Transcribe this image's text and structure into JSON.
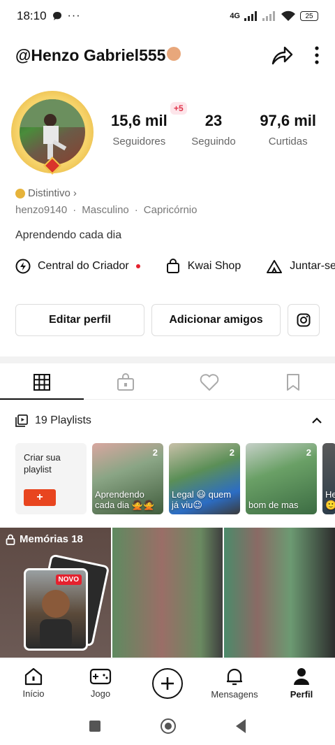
{
  "status": {
    "time": "18:10",
    "network": "4G",
    "battery": "25"
  },
  "header": {
    "username": "@Henzo Gabriel555"
  },
  "stats": [
    {
      "value": "15,6 mil",
      "label": "Seguidores"
    },
    {
      "value": "23",
      "label": "Seguindo"
    },
    {
      "value": "97,6 mil",
      "label": "Curtidas"
    }
  ],
  "plus_badge": "+5",
  "profile": {
    "distintivo": "Distintivo",
    "handle": "henzo9140",
    "gender": "Masculino",
    "sign": "Capricórnio",
    "bio": "Aprendendo cada dia"
  },
  "links": [
    {
      "label": "Central do Criador"
    },
    {
      "label": "Kwai Shop"
    },
    {
      "label": "Juntar-se"
    }
  ],
  "buttons": {
    "edit": "Editar perfil",
    "add_friends": "Adicionar amigos"
  },
  "playlists": {
    "header": "19 Playlists",
    "create_label": "Criar sua playlist",
    "create_button": "+",
    "items": [
      {
        "count": "2",
        "title": "Aprendendo cada dia 🙅🙅"
      },
      {
        "count": "2",
        "title": "Legal 😃 quem já viu😉"
      },
      {
        "count": "2",
        "title": "bom de mas"
      },
      {
        "count": "",
        "title": "He 🙂"
      }
    ]
  },
  "memories": {
    "label": "Memórias 18",
    "badge": "NOVO"
  },
  "nav": {
    "home": "Início",
    "game": "Jogo",
    "messages": "Mensagens",
    "profile": "Perfil"
  },
  "colors": {
    "accent_red": "#e5212e",
    "create_orange": "#e8451f",
    "badge_pink": "#fde5ea"
  }
}
